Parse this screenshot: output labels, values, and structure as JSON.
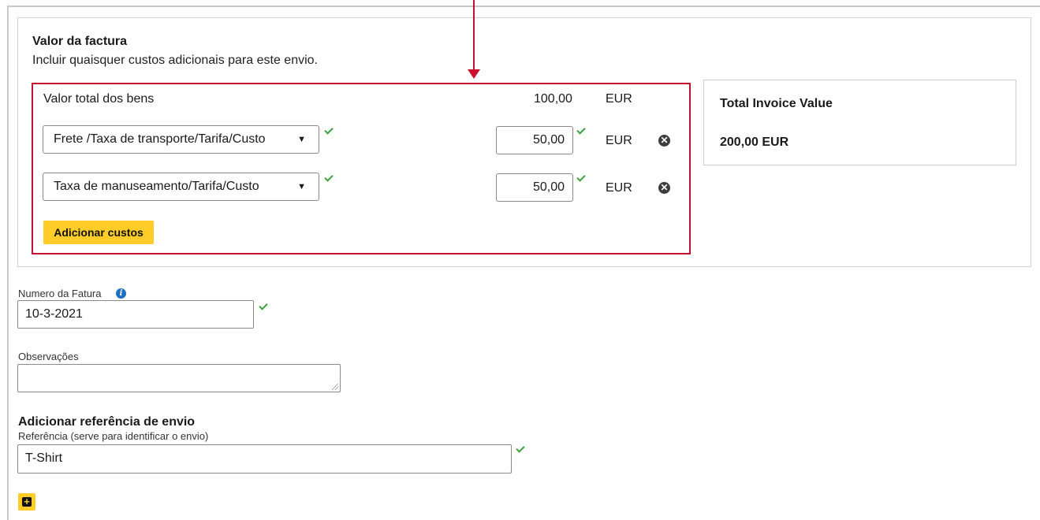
{
  "invoice": {
    "title": "Valor da factura",
    "subtitle": "Incluir quaisquer custos adicionais para este envio.",
    "goods_label": "Valor total dos bens",
    "goods_value": "100,00",
    "goods_currency": "EUR",
    "costs": [
      {
        "type": "Frete /Taxa de transporte/Tarifa/Custo",
        "amount": "50,00",
        "currency": "EUR"
      },
      {
        "type": "Taxa de manuseamento/Tarifa/Custo",
        "amount": "50,00",
        "currency": "EUR"
      }
    ],
    "add_costs_label": "Adicionar custos"
  },
  "summary": {
    "title": "Total Invoice Value",
    "value": "200,00 EUR"
  },
  "invoice_number": {
    "label": "Numero da Fatura",
    "value": "10-3-2021"
  },
  "observations": {
    "label": "Observações",
    "value": ""
  },
  "reference": {
    "section_title": "Adicionar referência de envio",
    "label": "Referência (serve para identificar o envio)",
    "value": "T-Shirt"
  },
  "icons": {
    "select_caret": "▼",
    "remove": "✕",
    "info": "i",
    "plus": "+"
  },
  "colors": {
    "highlight": "#c8102e",
    "accent_yellow": "#ffcc29",
    "valid_green": "#3aa13c",
    "info_blue": "#1f6fc2"
  }
}
